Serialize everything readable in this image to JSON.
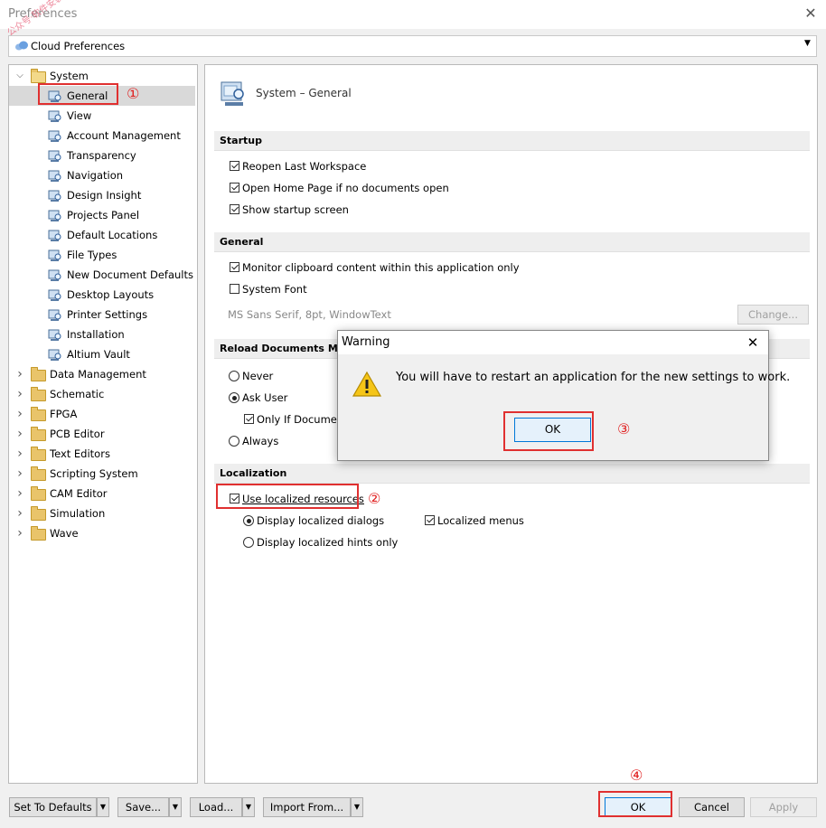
{
  "window": {
    "title": "Preferences",
    "watermark": "公众号·软件安装"
  },
  "cloud": {
    "label": "Cloud Preferences"
  },
  "tree": {
    "system": "System",
    "system_children": [
      "General",
      "View",
      "Account Management",
      "Transparency",
      "Navigation",
      "Design Insight",
      "Projects Panel",
      "Default Locations",
      "File Types",
      "New Document Defaults",
      "Desktop Layouts",
      "Printer Settings",
      "Installation",
      "Altium Vault"
    ],
    "top_items": [
      "Data Management",
      "Schematic",
      "FPGA",
      "PCB Editor",
      "Text Editors",
      "Scripting System",
      "CAM Editor",
      "Simulation",
      "Wave"
    ]
  },
  "panel": {
    "title": "System – General",
    "startup": {
      "header": "Startup",
      "opts": [
        "Reopen Last Workspace",
        "Open Home Page if no documents open",
        "Show startup screen"
      ]
    },
    "general": {
      "header": "General",
      "monitor": "Monitor clipboard content within this application only",
      "system_font": "System Font",
      "font_desc": "MS Sans Serif, 8pt, WindowText",
      "change_btn": "Change..."
    },
    "reload": {
      "header": "Reload Documents Modifi",
      "never": "Never",
      "ask": "Ask User",
      "only_if": "Only If Document",
      "always": "Always"
    },
    "localization": {
      "header": "Localization",
      "use_localized": "Use localized resources",
      "display_dialogs": "Display localized dialogs",
      "localized_menus": "Localized menus",
      "display_hints": "Display localized hints only"
    }
  },
  "dialog": {
    "title": "Warning",
    "message": "You will have to restart an application for the new settings to work.",
    "ok": "OK"
  },
  "annotations": {
    "a1": "①",
    "a2": "②",
    "a3": "③",
    "a4": "④"
  },
  "footer": {
    "set_defaults": "Set To Defaults",
    "save": "Save...",
    "load": "Load...",
    "import_from": "Import From...",
    "ok": "OK",
    "cancel": "Cancel",
    "apply": "Apply"
  },
  "colors": {
    "annotation_red": "#e03030",
    "accent_blue": "#0078d7"
  }
}
